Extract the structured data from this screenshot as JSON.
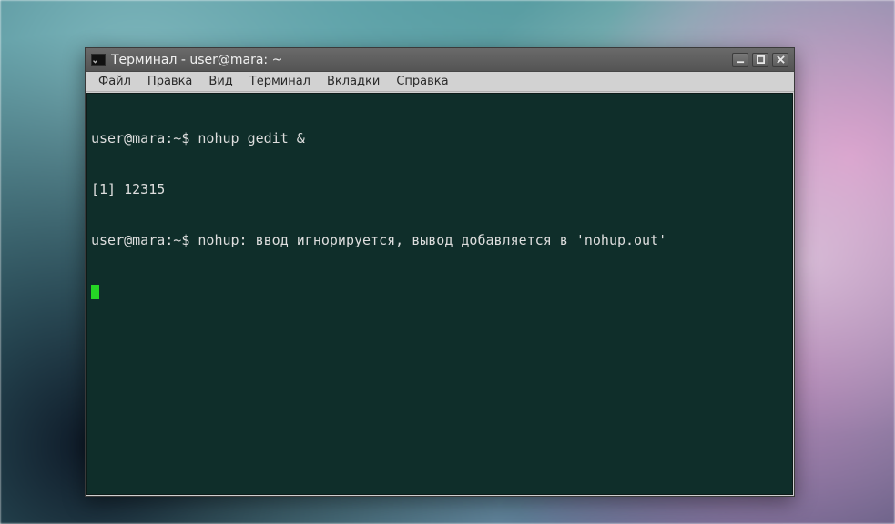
{
  "window": {
    "title": "Терминал - user@mara: ~"
  },
  "menubar": {
    "items": [
      {
        "label": "Файл"
      },
      {
        "label": "Правка"
      },
      {
        "label": "Вид"
      },
      {
        "label": "Терминал"
      },
      {
        "label": "Вкладки"
      },
      {
        "label": "Справка"
      }
    ]
  },
  "terminal": {
    "lines": [
      "user@mara:~$ nohup gedit &",
      "[1] 12315",
      "user@mara:~$ nohup: ввод игнорируется, вывод добавляется в 'nohup.out'"
    ]
  }
}
